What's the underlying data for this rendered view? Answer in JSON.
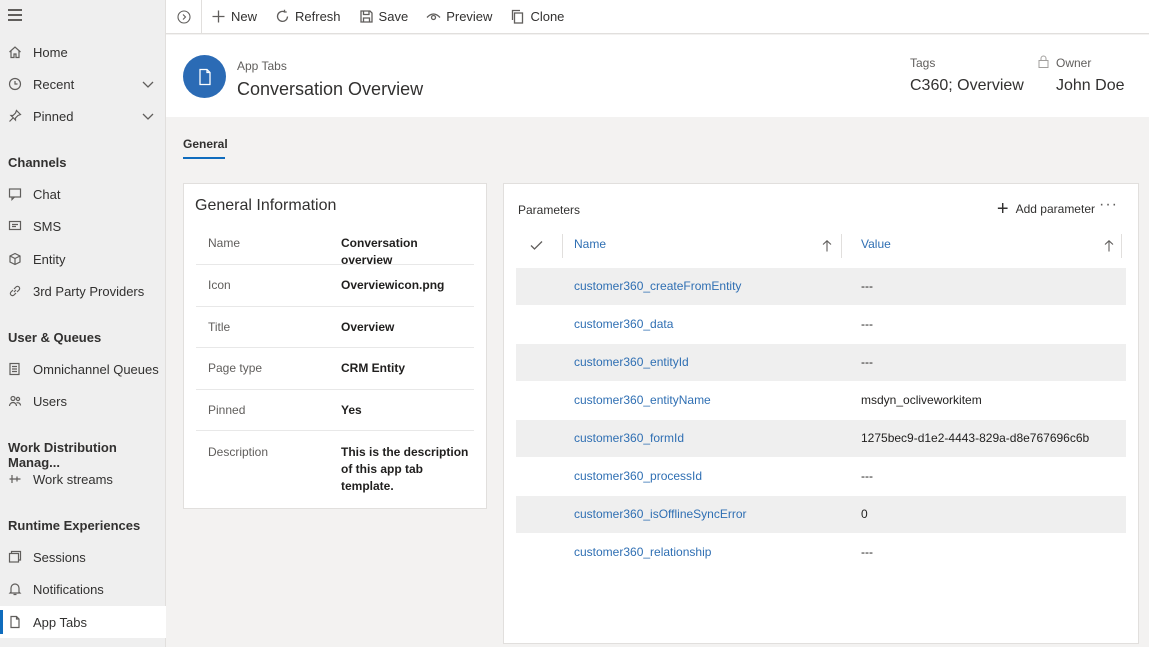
{
  "sidebar": {
    "items": [
      {
        "label": "Home"
      },
      {
        "label": "Recent"
      },
      {
        "label": "Pinned"
      }
    ],
    "sections": [
      {
        "header": "Channels",
        "items": [
          {
            "label": "Chat"
          },
          {
            "label": "SMS"
          },
          {
            "label": "Entity"
          },
          {
            "label": "3rd Party Providers"
          }
        ]
      },
      {
        "header": "User & Queues",
        "items": [
          {
            "label": "Omnichannel Queues"
          },
          {
            "label": "Users"
          }
        ]
      },
      {
        "header": "Work Distribution Manag...",
        "items": [
          {
            "label": "Work streams"
          }
        ]
      },
      {
        "header": "Runtime Experiences",
        "items": [
          {
            "label": "Sessions"
          },
          {
            "label": "Notifications"
          },
          {
            "label": "App Tabs"
          }
        ]
      }
    ]
  },
  "toolbar": {
    "new_label": "New",
    "refresh_label": "Refresh",
    "save_label": "Save",
    "preview_label": "Preview",
    "clone_label": "Clone"
  },
  "header": {
    "entity_type": "App Tabs",
    "title": "Conversation Overview",
    "tags_label": "Tags",
    "tags_value": "C360; Overview",
    "owner_label": "Owner",
    "owner_value": "John Doe"
  },
  "tabs": [
    {
      "label": "General",
      "selected": true
    }
  ],
  "general_info": {
    "title": "General Information",
    "rows": [
      {
        "label": "Name",
        "value": "Conversation overview"
      },
      {
        "label": "Icon",
        "value": "Overviewicon.png"
      },
      {
        "label": "Title",
        "value": "Overview"
      },
      {
        "label": "Page type",
        "value": "CRM Entity"
      },
      {
        "label": "Pinned",
        "value": "Yes"
      },
      {
        "label": "Description",
        "value": "This is the description of this app tab template."
      }
    ]
  },
  "parameters": {
    "title": "Parameters",
    "add_label": "Add parameter",
    "more_label": "···",
    "columns": {
      "name": "Name",
      "value": "Value"
    },
    "rows": [
      {
        "name": "customer360_createFromEntity",
        "value": "---"
      },
      {
        "name": "customer360_data",
        "value": "---"
      },
      {
        "name": "customer360_entityId",
        "value": "---"
      },
      {
        "name": "customer360_entityName",
        "value": "msdyn_ocliveworkitem"
      },
      {
        "name": "customer360_formId",
        "value": "1275bec9-d1e2-4443-829a-d8e767696c6b"
      },
      {
        "name": "customer360_processId",
        "value": "---"
      },
      {
        "name": "customer360_isOfflineSyncError",
        "value": "0"
      },
      {
        "name": "customer360_relationship",
        "value": "---"
      }
    ]
  },
  "colors": {
    "accent": "#0f6cbd",
    "avatar": "#2b6bb5",
    "link": "#2f6fb3"
  }
}
